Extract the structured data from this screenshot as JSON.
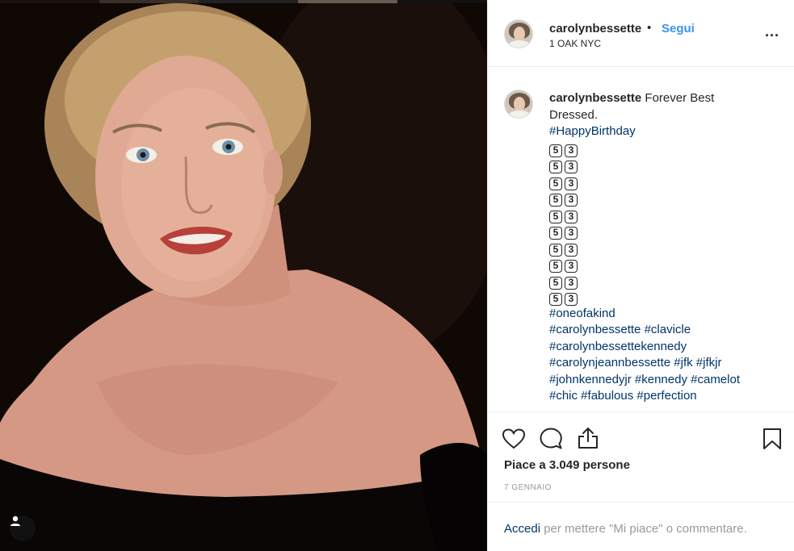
{
  "post": {
    "username": "carolynbessette",
    "separator": "•",
    "follow_label": "Segui",
    "location": "1 OAK NYC",
    "more_icon": "more-options-icon",
    "more_label": "..."
  },
  "caption": {
    "username": "carolynbessette",
    "text_line1": " Forever Best",
    "text_line2": "Dressed.",
    "hashtag_birthday": "#HappyBirthday",
    "keycap_rows": 10,
    "keycap_a": "5",
    "keycap_b": "3",
    "hashtags": [
      "#oneofakind",
      "#carolynbessette #clavicle",
      "#carolynbessettekennedy",
      "#carolynjeannbessette #jfk #jfkjr",
      "#johnkennedyjr #kennedy #camelot",
      "#chic #fabulous #perfection"
    ]
  },
  "actions": {
    "like_icon": "heart-icon",
    "comment_icon": "comment-icon",
    "share_icon": "share-icon",
    "save_icon": "bookmark-icon",
    "likes_text": "Piace a 3.049 persone",
    "date_text": "7 GENNAIO"
  },
  "login": {
    "link_label": "Accedi",
    "rest_label": " per mettere \"Mi piace\" o commentare."
  },
  "colors": {
    "link_blue": "#3897f0",
    "hashtag_blue": "#003569",
    "muted": "#999999",
    "border": "#efefef"
  }
}
